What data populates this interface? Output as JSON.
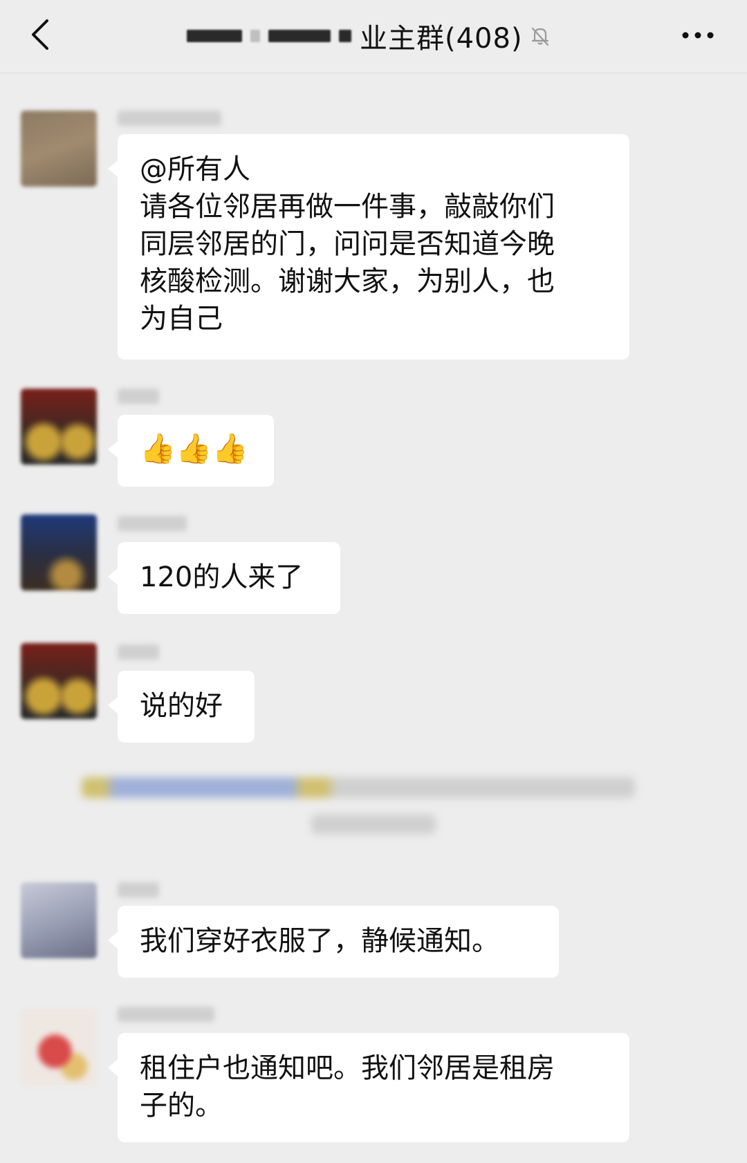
{
  "header": {
    "title_suffix": "业主群(408)",
    "back_icon": "chevron-left-icon",
    "mute_icon": "bell-muted-icon",
    "more_icon": "more-dots-icon"
  },
  "messages": [
    {
      "lines": [
        "@所有人",
        "请各位邻居再做一件事，敲敲你们",
        "同层邻居的门，问问是否知道今晚",
        "核酸检测。谢谢大家，为别人，也",
        "为自己"
      ]
    },
    {
      "emoji": "👍👍👍"
    },
    {
      "lines": [
        "120的人来了"
      ]
    },
    {
      "lines": [
        "说的好"
      ]
    },
    {
      "lines": [
        "我们穿好衣服了，静候通知。"
      ]
    },
    {
      "lines": [
        "租住户也通知吧。我们邻居是租房",
        "子的。"
      ]
    }
  ],
  "colors": {
    "background": "#ededed",
    "bubble": "#ffffff",
    "text": "#111111"
  }
}
